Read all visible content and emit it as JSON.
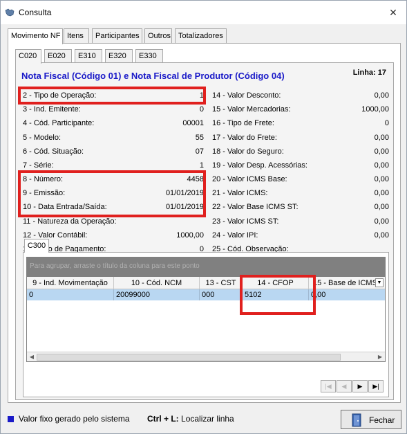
{
  "window": {
    "title": "Consulta",
    "close_glyph": "✕",
    "app_icon": "map-icon"
  },
  "tabs": [
    "Movimento NF",
    "Itens",
    "Participantes",
    "Outros",
    "Totalizadores"
  ],
  "subtabs": [
    "C020",
    "E020",
    "E310",
    "E320",
    "E330"
  ],
  "section": {
    "title": "Nota Fiscal (Código 01) e Nota Fiscal de Produtor (Código 04)",
    "linha": "Linha:  17"
  },
  "left_fields": [
    {
      "label": "2 - Tipo de Operação:",
      "value": "1"
    },
    {
      "label": "3 - Ind. Emitente:",
      "value": "0"
    },
    {
      "label": "4 - Cód. Participante:",
      "value": "00001"
    },
    {
      "label": "5 - Modelo:",
      "value": "55"
    },
    {
      "label": "6 - Cód. Situação:",
      "value": "07"
    },
    {
      "label": "7 - Série:",
      "value": "1"
    },
    {
      "label": "8 - Número:",
      "value": "4458"
    },
    {
      "label": "9 - Emissão:",
      "value": "01/01/2019"
    },
    {
      "label": "10 - Data Entrada/Saída:",
      "value": "01/01/2019"
    },
    {
      "label": "11 - Natureza da Operação:",
      "value": ""
    },
    {
      "label": "12 - Valor Contábil:",
      "value": "1000,00"
    },
    {
      "label": "13 - Tipo de Pagamento:",
      "value": "0"
    }
  ],
  "right_fields": [
    {
      "label": "14 - Valor Desconto:",
      "value": "0,00"
    },
    {
      "label": "15 - Valor Mercadorias:",
      "value": "1000,00"
    },
    {
      "label": "16 - Tipo de Frete:",
      "value": "0"
    },
    {
      "label": "17 - Valor do Frete:",
      "value": "0,00"
    },
    {
      "label": "18 - Valor do Seguro:",
      "value": "0,00"
    },
    {
      "label": "19 - Valor Desp. Acessórias:",
      "value": "0,00"
    },
    {
      "label": "20 - Valor ICMS Base:",
      "value": "0,00"
    },
    {
      "label": "21 - Valor ICMS:",
      "value": "0,00"
    },
    {
      "label": "22 - Valor Base ICMS ST:",
      "value": "0,00"
    },
    {
      "label": "23 - Valor ICMS ST:",
      "value": "0,00"
    },
    {
      "label": "24 - Valor IPI:",
      "value": "0,00"
    },
    {
      "label": "25 - Cód. Observação:",
      "value": ""
    }
  ],
  "c300": {
    "tab_label": "C300",
    "group_hint": "Para agrupar, arraste o título da coluna para este ponto",
    "columns": [
      "9 - Ind. Movimentação",
      "10 - Cód. NCM",
      "13 - CST",
      "14 - CFOP",
      "15 - Base de ICMS"
    ],
    "rows": [
      [
        "0",
        "20099000",
        "000",
        "5102",
        "0,00"
      ]
    ]
  },
  "nav_buttons": [
    "|◀",
    "◀",
    "▶",
    "▶|"
  ],
  "footer": {
    "legend": "Valor fixo gerado pelo sistema",
    "shortcut_key": "Ctrl + L:",
    "shortcut_action": "Localizar linha",
    "close_button": "Fechar"
  },
  "colors": {
    "title_blue": "#1a1ac8",
    "highlight_red": "#e0201e",
    "selected_row": "#b9d7f2"
  }
}
